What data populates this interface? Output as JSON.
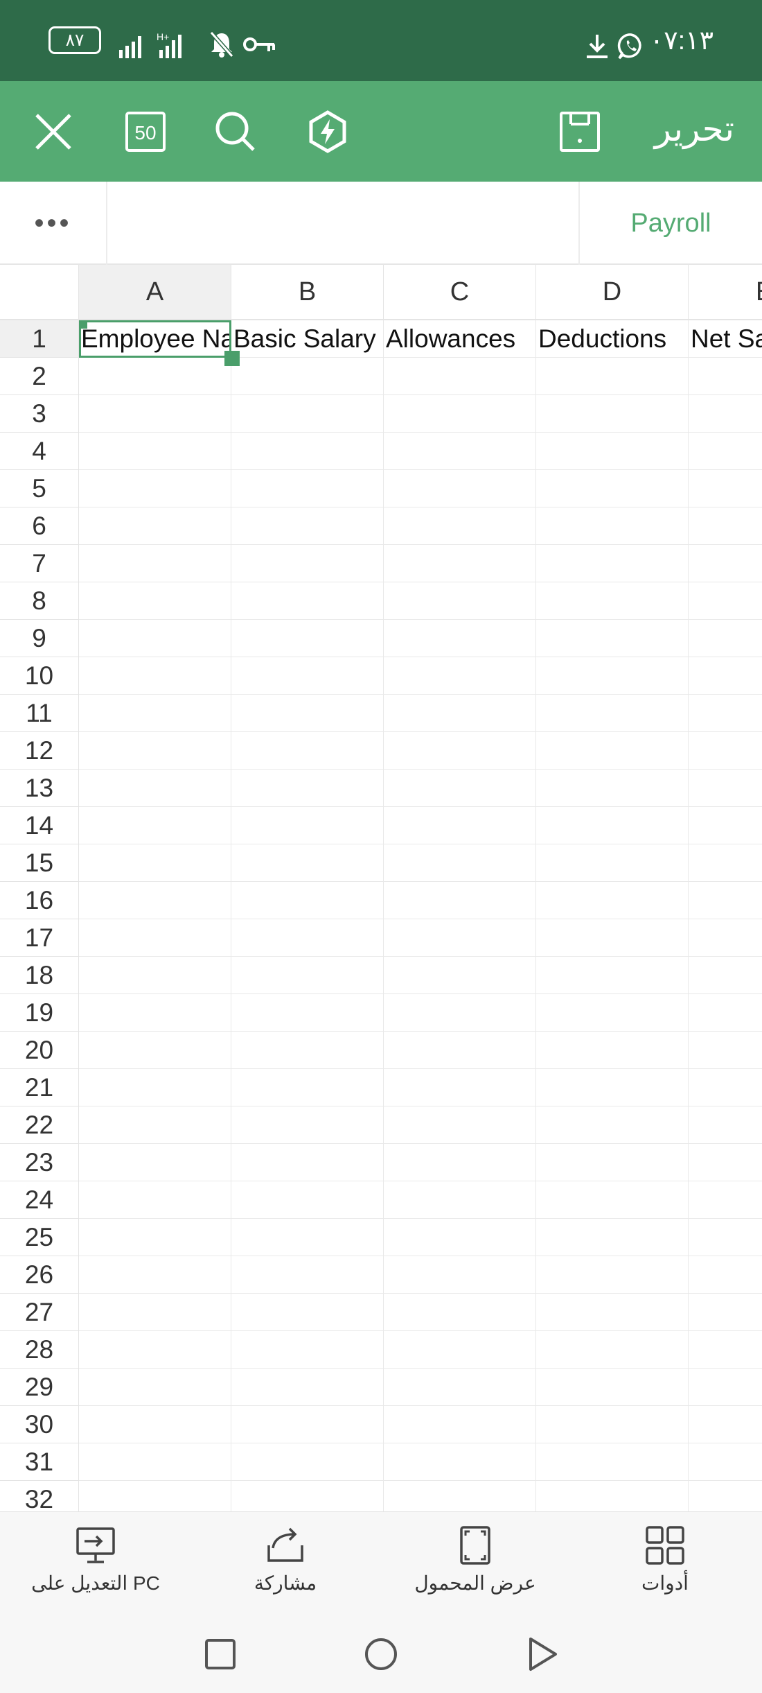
{
  "status_bar": {
    "battery": "٨٧",
    "time": "٠٧:١٣"
  },
  "toolbar": {
    "title": "تحرير",
    "count_badge": "50"
  },
  "sheet": {
    "name": "Payroll",
    "more": "•••"
  },
  "grid": {
    "columns": [
      "A",
      "B",
      "C",
      "D",
      "E"
    ],
    "rows": [
      "1",
      "2",
      "3",
      "4",
      "5",
      "6",
      "7",
      "8",
      "9",
      "10",
      "11",
      "12",
      "13",
      "14",
      "15",
      "16",
      "17",
      "18",
      "19",
      "20",
      "21",
      "22",
      "23",
      "24",
      "25",
      "26",
      "27",
      "28",
      "29",
      "30",
      "31",
      "32"
    ],
    "row1_cells": [
      "Employee Name",
      "Basic Salary",
      "Allowances",
      "Deductions",
      "Net Salary"
    ]
  },
  "bottom_bar": {
    "edit_pc": "التعديل على PC",
    "share": "مشاركة",
    "mobile_view": "عرض المحمول",
    "tools": "أدوات"
  },
  "colors": {
    "status": "#2e6b49",
    "toolbar": "#55ab73",
    "accent": "#4a9e6a"
  }
}
